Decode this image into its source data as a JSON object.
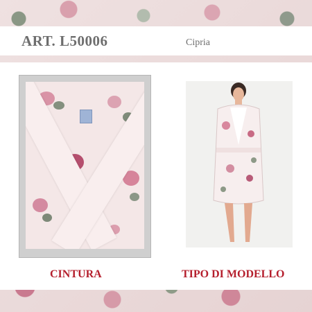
{
  "header": {
    "article_label": "ART.  L50006",
    "color_name": "Cipria"
  },
  "labels": {
    "left": "CINTURA",
    "right": "TIPO DI MODELLO"
  }
}
